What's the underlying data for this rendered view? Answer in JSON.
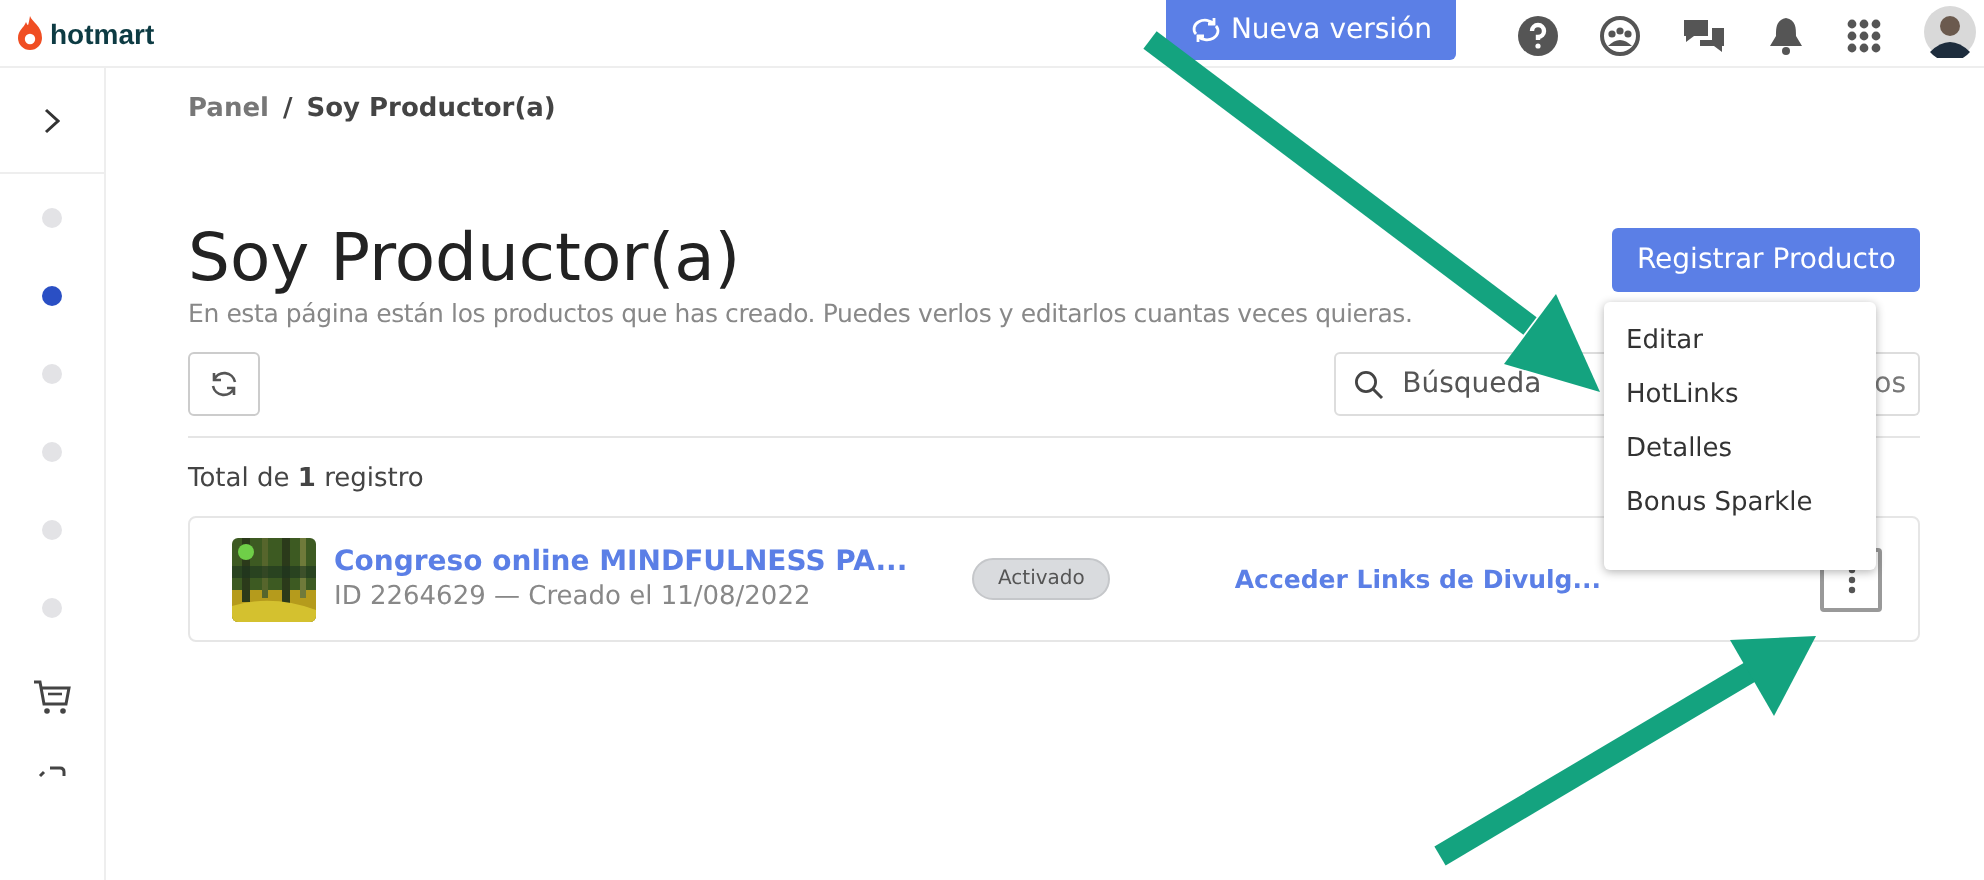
{
  "header": {
    "logo": "hotmart",
    "new_version_button": "Nueva versión"
  },
  "sidebar": {
    "items": [
      {
        "kind": "dot",
        "selected": false
      },
      {
        "kind": "dot",
        "selected": true
      },
      {
        "kind": "dot",
        "selected": false
      },
      {
        "kind": "dot",
        "selected": false
      },
      {
        "kind": "dot",
        "selected": false
      },
      {
        "kind": "dot",
        "selected": false
      },
      {
        "kind": "cart"
      },
      {
        "kind": "partial"
      }
    ]
  },
  "breadcrumb": [
    "Panel",
    "/",
    "Soy Productor(a)"
  ],
  "title": "Soy Productor(a)",
  "subtitle": "En esta página están los productos que has creado. Puedes verlos y editarlos cuantas veces quieras.",
  "register_button": "Registrar Producto",
  "search": {
    "placeholder": "Búsqueda"
  },
  "filter_button": "os",
  "total": "Total de **1** registro",
  "products": [
    {
      "name": "Congreso online MINDFULNESS PA...",
      "meta": "ID 2264629 — Creado el 11/08/2022",
      "status": "Activado",
      "link": "Acceder Links de Divulg..."
    }
  ],
  "menu": {
    "items": [
      "Editar",
      "HotLinks",
      "Detalles",
      "Bonus Sparkle"
    ]
  }
}
